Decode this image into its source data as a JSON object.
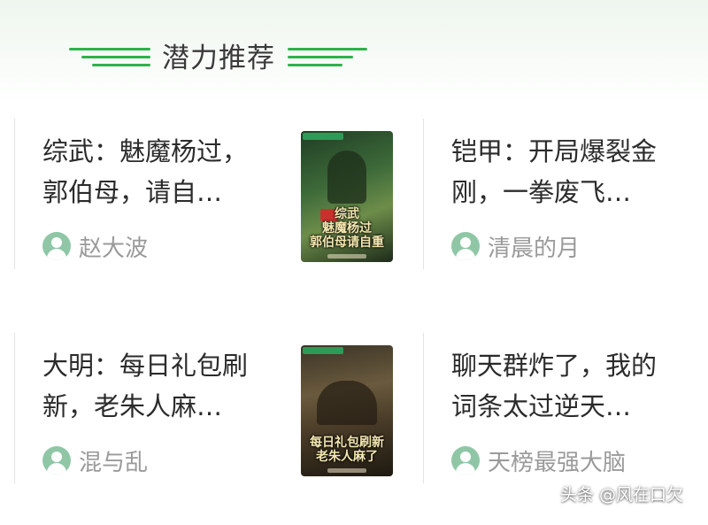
{
  "section": {
    "title": "潜力推荐"
  },
  "books": [
    {
      "title": "综武：魅魔杨过，\n郭伯母，请自…",
      "author": "赵大波",
      "cover_text": "综武\n魅魔杨过\n郭伯母请自重"
    },
    {
      "title": "铠甲：开局爆裂金\n刚，一拳废飞…",
      "author": "清晨的月"
    },
    {
      "title": "大明：每日礼包刷\n新，老朱人麻…",
      "author": "混与乱",
      "cover_text": "每日礼包刷新\n老朱人麻了"
    },
    {
      "title": "聊天群炸了，我的\n词条太过逆天…",
      "author": "天榜最强大脑"
    }
  ],
  "watermark": "头条 @风在口欠",
  "colors": {
    "accent": "#2fb14b",
    "author_icon": "#8fc7a6"
  },
  "icons": {
    "author": "user-avatar-icon",
    "decoration": "green-line-decoration"
  }
}
